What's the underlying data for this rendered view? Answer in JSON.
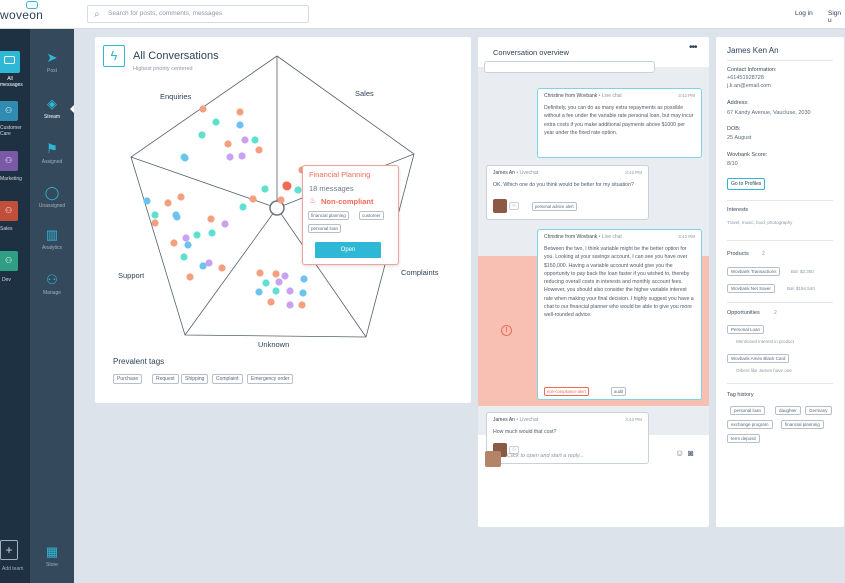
{
  "app": {
    "logo": "woveon",
    "search_placeholder": "Search for posts, comments, messages",
    "login": "Log in",
    "signup": "Sign u"
  },
  "teams": [
    {
      "label": "All\nmessages",
      "color": "#2fb8d6"
    },
    {
      "label": "Customer\nCare",
      "color": "#2f8bb0"
    },
    {
      "label": "Marketing",
      "color": "#7a5aa6"
    },
    {
      "label": "Sales",
      "color": "#c0503c"
    },
    {
      "label": "Dev",
      "color": "#2f9e85"
    }
  ],
  "teams_add_label": "Add team",
  "nav": [
    {
      "label": "Post",
      "icon": "send-icon"
    },
    {
      "label": "Stream",
      "icon": "stack-icon"
    },
    {
      "label": "Assigned",
      "icon": "flag-icon"
    },
    {
      "label": "Unassigned",
      "icon": "chat-icon"
    },
    {
      "label": "Analytics",
      "icon": "bar-chart-icon"
    },
    {
      "label": "Manage",
      "icon": "people-icon"
    },
    {
      "label": "Store",
      "icon": "store-icon"
    }
  ],
  "conversations": {
    "title": "All Conversations",
    "subtitle": "Highest priority centered",
    "axes": [
      "Enquiries",
      "Sales",
      "Complaints",
      "Unknown",
      "Support"
    ],
    "popup": {
      "title": "Financial Planning",
      "count": "18 messages",
      "status": "Non-compliant",
      "tags": [
        "financial planning",
        "customer",
        "personal loan"
      ],
      "button": "Open"
    },
    "prevalent_title": "Prevalent tags",
    "prevalent_tags": [
      "Purchase",
      "Request",
      "Shipping",
      "Complaint",
      "Emergency order"
    ]
  },
  "overview": {
    "title": "Conversation overview",
    "messages": [
      {
        "who": "Christine from Wovbank",
        "channel": "• Live chat",
        "time": "3:42 PM",
        "text": "Definitely, you can do as many extra repayments as possible without a fee under the variable rate personal loan, but may incur extra costs if you make additional payments above $1000 per year under the fixed rate option."
      },
      {
        "who": "James An",
        "channel": "• Livechat",
        "time": "3:42 PM",
        "text": "OK. Which one do you think would be better for my situation?",
        "tag": "personal advice alert"
      },
      {
        "who": "Christine from Wovbank",
        "channel": "• Live chat",
        "time": "3:43 PM",
        "text": "Between the two, I think variable might be the better option for you. Looking at your savings account, I can see you have over $150,000. Having a variable account would give you the opportunity to pay back the loan faster if you wished to, thereby reducing overall costs in interests and monthly account fees. However, you should also consider the higher variable interest rate when making your final decision. I highly suggest you have a chat to our financial planner who would be able to give you more well-rounded advice.",
        "tags": [
          "non-compliance alert",
          "audit"
        ]
      },
      {
        "who": "James An",
        "channel": "• Livechat",
        "time": "3:43 PM",
        "text": "How much would that cost?"
      }
    ],
    "reply_placeholder": "Click to open and start a reply..."
  },
  "contact": {
    "name": "James Ken An",
    "contact_label": "Contact Information:",
    "phone": "+61451928728",
    "email": "j.k.an@email.com",
    "address_label": "Address:",
    "address": "67 Kandy Avenue, Vaucluse, 2030",
    "dob_label": "DOB:",
    "dob": "25 August",
    "score_label": "Wovbank Score:",
    "score": "8/10",
    "profiles_button": "Go to Profiles",
    "interests_label": "Interests",
    "interests": "Travel, music, food, photography",
    "products_label": "Products",
    "products_count": "2",
    "products": [
      {
        "name": "Wovbank Transactions",
        "bal": "Bal: $2,350"
      },
      {
        "name": "Wovbank Net Saver",
        "bal": "Bal: $194,540"
      }
    ],
    "opportunities_label": "Opportunities",
    "opportunities_count": "2",
    "opportunities": [
      {
        "name": "Personal Loan",
        "note": "Mentioned interest in product"
      },
      {
        "name": "Wovbank Amex Black Card",
        "note": "Others like James have one"
      }
    ],
    "tag_history_label": "Tag history",
    "tag_history": [
      "personal loan",
      "daughter",
      "Germany",
      "exchange program",
      "financial planning",
      "term deposit"
    ]
  },
  "colors": {
    "accent": "#2fb8d6",
    "alert": "#ef6b57",
    "dot_orange": "#f4a07e",
    "dot_teal": "#5ee0d0",
    "dot_blue": "#6cc3f0",
    "dot_purple": "#c8a2f0"
  }
}
